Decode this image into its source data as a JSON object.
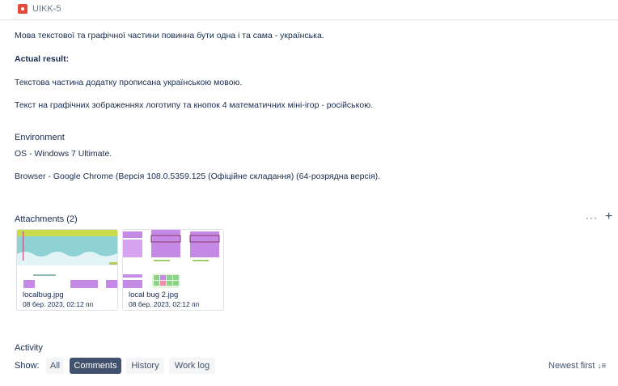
{
  "issue": {
    "key": "UIKK-5",
    "type_icon": "bug-icon"
  },
  "description": {
    "line1": "Мова текстової та графічної частини повинна бути одна і та сама - українська.",
    "actual_heading": "Actual result:",
    "line2": "Текстова частина додатку прописана українською мовою.",
    "line3": "Текст на графічних зображеннях логотипу та кнопок 4 математичних міні-ігор - російською.",
    "env_heading": "Environment",
    "os": "OS - Windows 7 Ultimate.",
    "browser": "Browser - Google Chrome (Версія 108.0.5359.125 (Офіційне складання) (64-розрядна версія)."
  },
  "attachments": {
    "heading": "Attachments (2)",
    "items": [
      {
        "name": "localbug.jpg",
        "date": "08 бер. 2023, 02:12 пп"
      },
      {
        "name": "local bug 2.jpg",
        "date": "08 бер. 2023, 02:12 пп"
      }
    ]
  },
  "activity": {
    "heading": "Activity",
    "show_label": "Show:",
    "tabs": [
      "All",
      "Comments",
      "History",
      "Work log"
    ],
    "active_tab": "Comments",
    "sort_label": "Newest first"
  },
  "colors": {
    "bug": "#e5493a",
    "active_tab": "#42526e",
    "tab_bg": "#f4f5f7"
  }
}
